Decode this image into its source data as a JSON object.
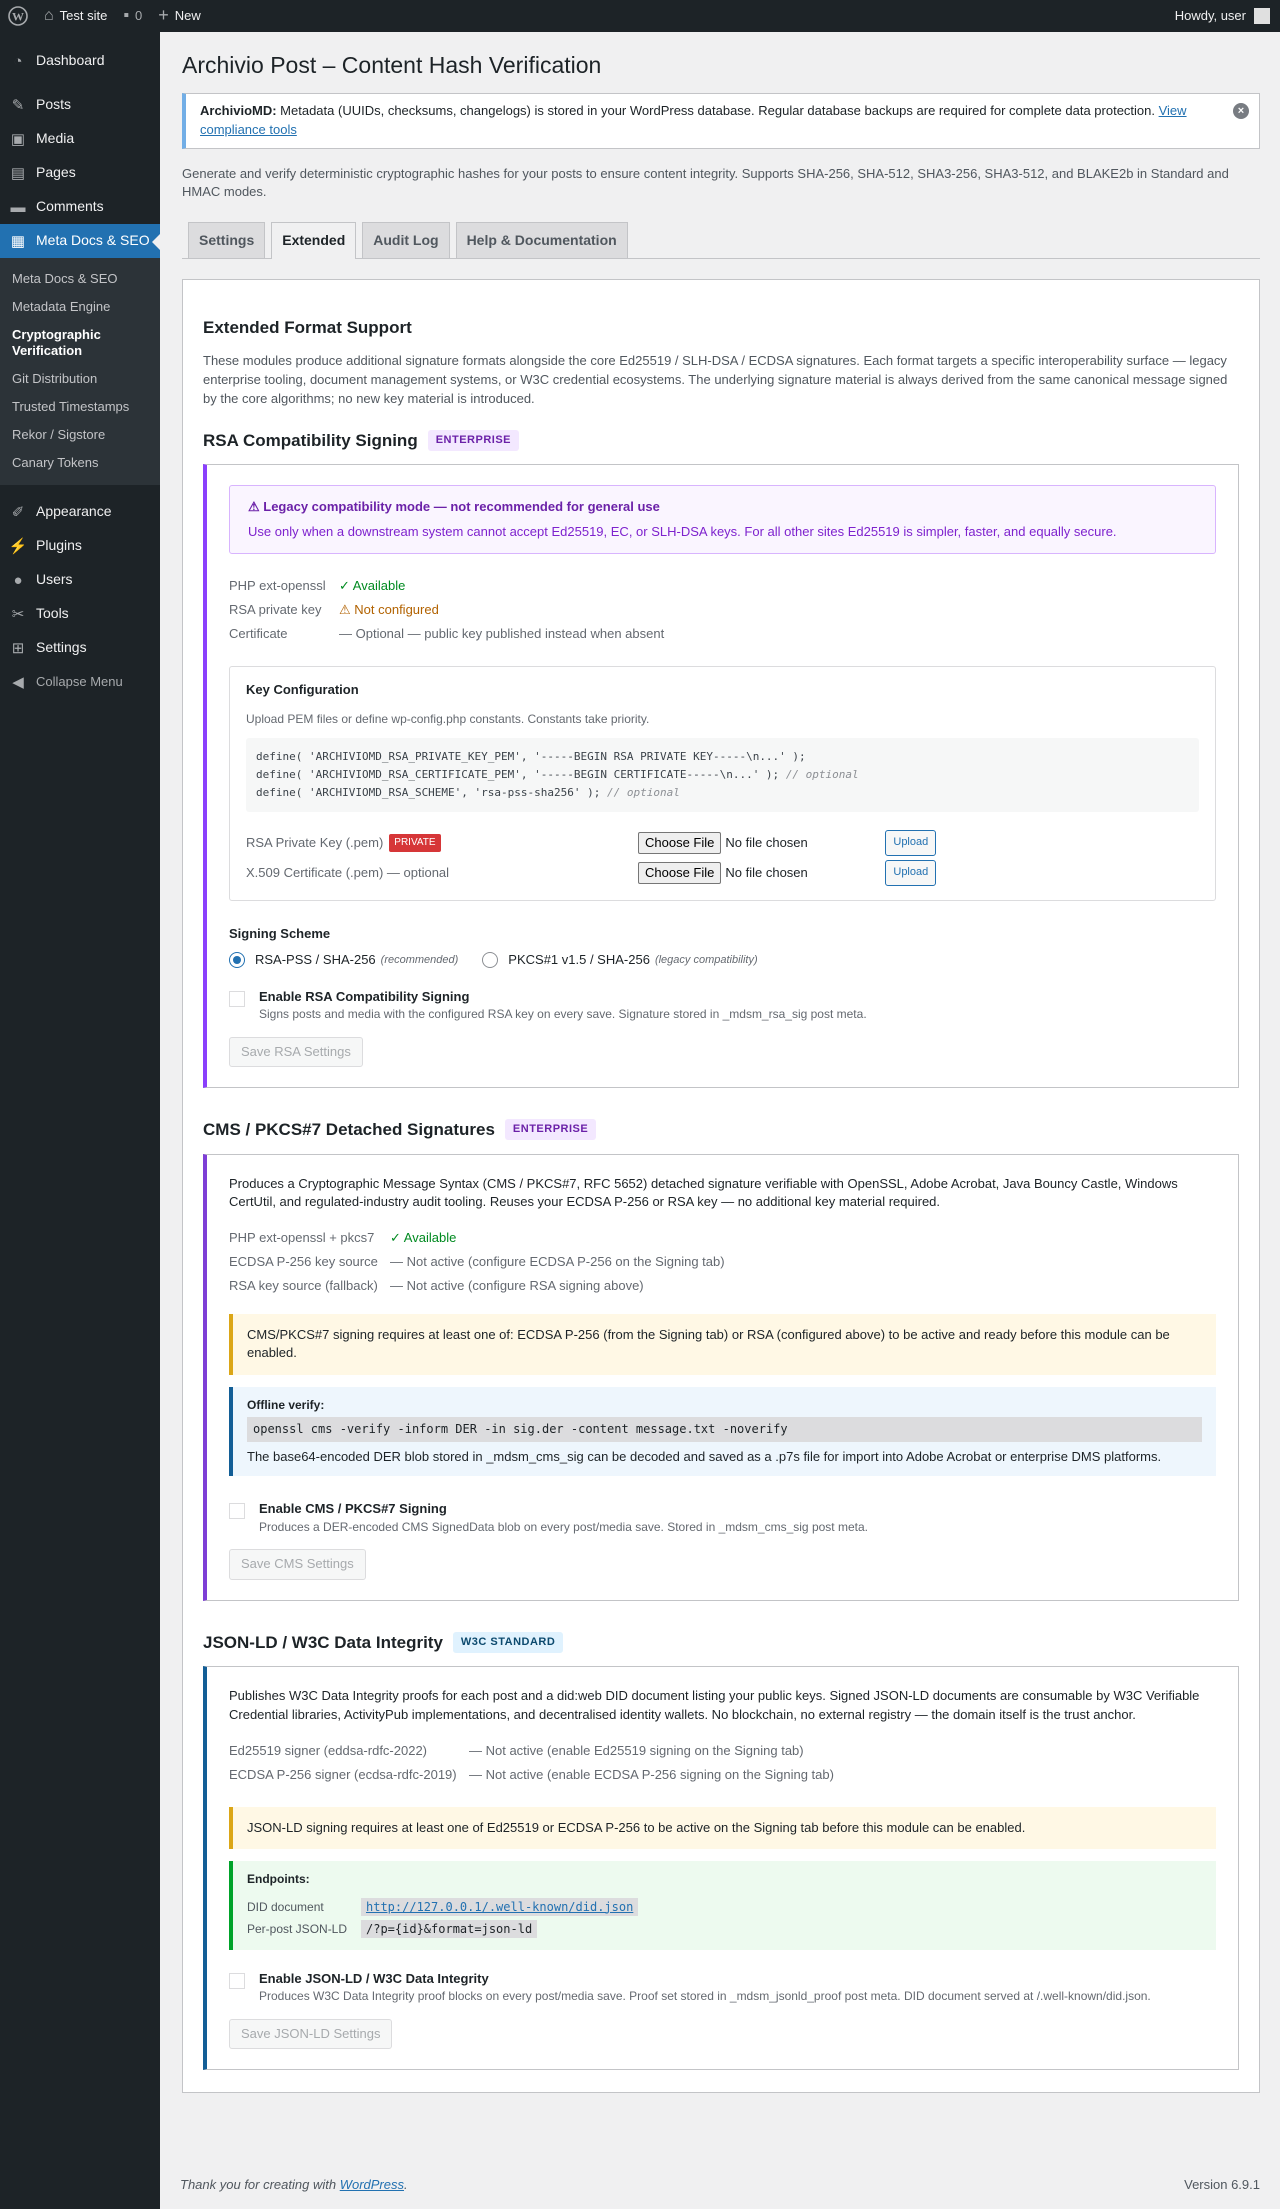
{
  "adminbar": {
    "site_name": "Test site",
    "comments_count": "0",
    "new_label": "New",
    "howdy": "Howdy, user"
  },
  "sidebar": {
    "items_top": [
      {
        "label": "Dashboard",
        "icon": "dashboard-icon"
      }
    ],
    "items_content": [
      {
        "label": "Posts",
        "icon": "pin-icon"
      },
      {
        "label": "Media",
        "icon": "media-icon"
      },
      {
        "label": "Pages",
        "icon": "pages-icon"
      },
      {
        "label": "Comments",
        "icon": "comments-icon"
      },
      {
        "label": "Meta Docs & SEO",
        "icon": "document-icon"
      }
    ],
    "submenu": [
      "Meta Docs & SEO",
      "Metadata Engine",
      "Cryptographic Verification",
      "Git Distribution",
      "Trusted Timestamps",
      "Rekor / Sigstore",
      "Canary Tokens"
    ],
    "items_bottom": [
      {
        "label": "Appearance",
        "icon": "brush-icon"
      },
      {
        "label": "Plugins",
        "icon": "plugin-icon"
      },
      {
        "label": "Users",
        "icon": "users-icon"
      },
      {
        "label": "Tools",
        "icon": "wrench-icon"
      },
      {
        "label": "Settings",
        "icon": "settings-icon"
      }
    ],
    "collapse": "Collapse Menu"
  },
  "page": {
    "title": "Archivio Post – Content Hash Verification",
    "notice_brand": "ArchivioMD:",
    "notice_text": " Metadata (UUIDs, checksums, changelogs) is stored in your WordPress database. Regular database backups are required for complete data protection. ",
    "notice_link": "View compliance tools",
    "intro": "Generate and verify deterministic cryptographic hashes for your posts to ensure content integrity. Supports SHA-256, SHA-512, SHA3-256, SHA3-512, and BLAKE2b in Standard and HMAC modes.",
    "tabs": [
      "Settings",
      "Extended",
      "Audit Log",
      "Help & Documentation"
    ]
  },
  "extended": {
    "heading": "Extended Format Support",
    "description": "These modules produce additional signature formats alongside the core Ed25519 / SLH-DSA / ECDSA signatures. Each format targets a specific interoperability surface — legacy enterprise tooling, document management systems, or W3C credential ecosystems. The underlying signature material is always derived from the same canonical message signed by the core algorithms; no new key material is introduced."
  },
  "rsa": {
    "title": "RSA Compatibility Signing",
    "badge": "ENTERPRISE",
    "warn_title": "⚠ Legacy compatibility mode — not recommended for general use",
    "warn_body": "Use only when a downstream system cannot accept Ed25519, EC, or SLH-DSA keys. For all other sites Ed25519 is simpler, faster, and equally secure.",
    "status": [
      {
        "k": "PHP ext-openssl",
        "v": "✓ Available"
      },
      {
        "k": "RSA private key",
        "v": "⚠ Not configured"
      },
      {
        "k": "Certificate",
        "v": "— Optional — public key published instead when absent"
      }
    ],
    "key_title": "Key Configuration",
    "key_desc": "Upload PEM files or define wp-config.php constants. Constants take priority.",
    "code_line1": "define( 'ARCHIVIOMD_RSA_PRIVATE_KEY_PEM', '-----BEGIN RSA PRIVATE KEY-----\\n...' );",
    "code_line2": "define( 'ARCHIVIOMD_RSA_CERTIFICATE_PEM', '-----BEGIN CERTIFICATE-----\\n...' ); ",
    "code_line2_comment": "// optional",
    "code_line3": "define( 'ARCHIVIOMD_RSA_SCHEME', 'rsa-pss-sha256' ); ",
    "code_line3_comment": "// optional",
    "file_rows": [
      {
        "label": "RSA Private Key (.pem)",
        "pill": "PRIVATE"
      },
      {
        "label": "X.509 Certificate (.pem) — optional",
        "pill": ""
      }
    ],
    "choose_file": "Choose File",
    "no_file": "No file chosen",
    "upload": "Upload",
    "scheme_title": "Signing Scheme",
    "scheme_options": [
      {
        "label": "RSA-PSS / SHA-256",
        "note": "(recommended)",
        "selected": true
      },
      {
        "label": "PKCS#1 v1.5 / SHA-256",
        "note": "(legacy compatibility)",
        "selected": false
      }
    ],
    "enable_title": "Enable RSA Compatibility Signing",
    "enable_desc": "Signs posts and media with the configured RSA key on every save. Signature stored in _mdsm_rsa_sig post meta.",
    "save": "Save RSA Settings"
  },
  "cms": {
    "title": "CMS / PKCS#7 Detached Signatures",
    "badge": "ENTERPRISE",
    "body": "Produces a Cryptographic Message Syntax (CMS / PKCS#7, RFC 5652) detached signature verifiable with OpenSSL, Adobe Acrobat, Java Bouncy Castle, Windows CertUtil, and regulated-industry audit tooling. Reuses your ECDSA P-256 or RSA key — no additional key material required.",
    "status": [
      {
        "k": "PHP ext-openssl + pkcs7",
        "v": "✓ Available"
      },
      {
        "k": "ECDSA P-256 key source",
        "v": "— Not active (configure ECDSA P-256 on the Signing tab)"
      },
      {
        "k": "RSA key source (fallback)",
        "v": "— Not active (configure RSA signing above)"
      }
    ],
    "requirement": "CMS/PKCS#7 signing requires at least one of: ECDSA P-256 (from the Signing tab) or RSA (configured above) to be active and ready before this module can be enabled.",
    "verify_title": "Offline verify:",
    "verify_cmd": "openssl cms -verify -inform DER -in sig.der -content message.txt -noverify",
    "verify_note": "The base64-encoded DER blob stored in _mdsm_cms_sig can be decoded and saved as a .p7s file for import into Adobe Acrobat or enterprise DMS platforms.",
    "enable_title": "Enable CMS / PKCS#7 Signing",
    "enable_desc": "Produces a DER-encoded CMS SignedData blob on every post/media save. Stored in _mdsm_cms_sig post meta.",
    "save": "Save CMS Settings"
  },
  "jsonld": {
    "title": "JSON-LD / W3C Data Integrity",
    "badge": "W3C STANDARD",
    "body": "Publishes W3C Data Integrity proofs for each post and a did:web DID document listing your public keys. Signed JSON-LD documents are consumable by W3C Verifiable Credential libraries, ActivityPub implementations, and decentralised identity wallets. No blockchain, no external registry — the domain itself is the trust anchor.",
    "status": [
      {
        "k": "Ed25519 signer (eddsa-rdfc-2022)",
        "v": "— Not active (enable Ed25519 signing on the Signing tab)"
      },
      {
        "k": "ECDSA P-256 signer (ecdsa-rdfc-2019)",
        "v": "— Not active (enable ECDSA P-256 signing on the Signing tab)"
      }
    ],
    "requirement": "JSON-LD signing requires at least one of Ed25519 or ECDSA P-256 to be active on the Signing tab before this module can be enabled.",
    "endpoints_title": "Endpoints:",
    "did_label": "DID document",
    "did_url": "http://127.0.0.1/.well-known/did.json",
    "perpost_label": "Per-post JSON-LD",
    "perpost_val": "/?p={id}&format=json-ld",
    "enable_title": "Enable JSON-LD / W3C Data Integrity",
    "enable_desc": "Produces W3C Data Integrity proof blocks on every post/media save. Proof set stored in _mdsm_jsonld_proof post meta. DID document served at /.well-known/did.json.",
    "save": "Save JSON-LD Settings"
  },
  "footer": {
    "thanks_prefix": "Thank you for creating with ",
    "thanks_link": "WordPress",
    "thanks_suffix": ".",
    "version": "Version 6.9.1"
  }
}
